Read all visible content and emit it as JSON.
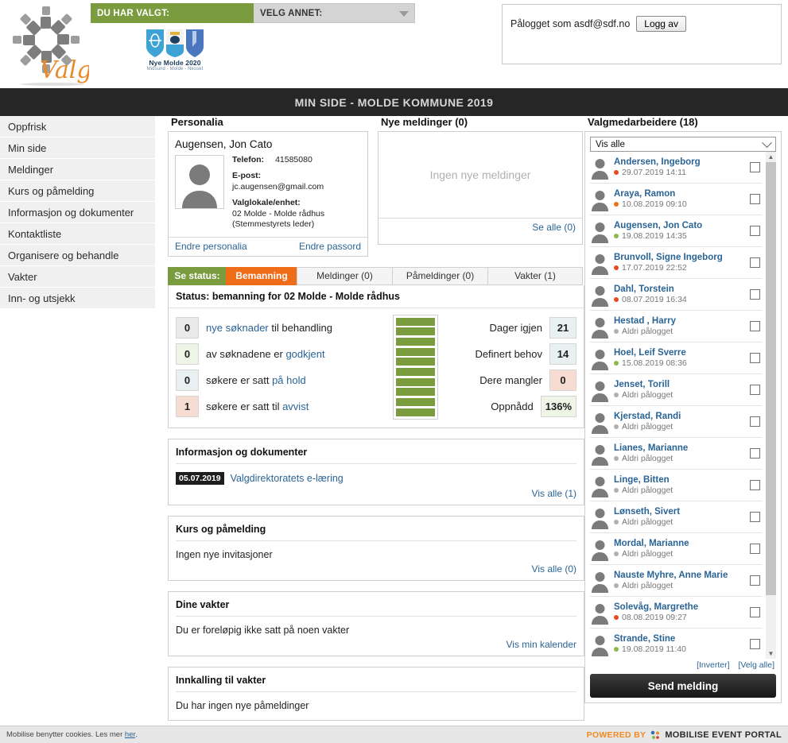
{
  "top": {
    "selected_label": "DU HAR VALGT:",
    "other_label": "VELG ANNET:",
    "crest_title": "Nye Molde 2020",
    "crest_sub": "Midsund - Molde - Nesset",
    "login_text": "Pålogget som asdf@sdf.no",
    "logout_label": "Logg av"
  },
  "header": {
    "title": "MIN SIDE - MOLDE KOMMUNE 2019"
  },
  "sidebar": {
    "items": [
      {
        "label": "Oppfrisk"
      },
      {
        "label": "Min side"
      },
      {
        "label": "Meldinger"
      },
      {
        "label": "Kurs og påmelding"
      },
      {
        "label": "Informasjon og dokumenter"
      },
      {
        "label": "Kontaktliste"
      },
      {
        "label": "Organisere og behandle"
      },
      {
        "label": "Vakter"
      },
      {
        "label": "Inn- og utsjekk"
      }
    ]
  },
  "personalia": {
    "section_title": "Personalia",
    "name": "Augensen, Jon Cato",
    "phone_label": "Telefon:",
    "phone_value": "41585080",
    "email_label": "E-post:",
    "email_value": "jc.augensen@gmail.com",
    "venue_label": "Valglokale/enhet:",
    "venue_value": "02 Molde - Molde rådhus",
    "venue_role": "(Stemmestyrets leder)",
    "edit_personalia": "Endre personalia",
    "edit_password": "Endre passord"
  },
  "messages": {
    "section_title": "Nye meldinger (0)",
    "empty_text": "Ingen nye meldinger",
    "see_all": "Se alle (0)"
  },
  "tabs": {
    "status_label": "Se status:",
    "items": [
      {
        "label": "Bemanning",
        "active": true
      },
      {
        "label": "Meldinger (0)",
        "active": false
      },
      {
        "label": "Påmeldinger (0)",
        "active": false
      },
      {
        "label": "Vakter (1)",
        "active": false
      }
    ]
  },
  "status": {
    "heading": "Status: bemanning for 02 Molde - Molde rådhus",
    "left_rows": [
      {
        "num": "0",
        "text_pre": "",
        "text_link": "nye søknader",
        "text_post": " til behandling",
        "tone": "grey"
      },
      {
        "num": "0",
        "text_pre": "av søknadene er ",
        "text_link": "godkjent",
        "text_post": "",
        "tone": "green"
      },
      {
        "num": "0",
        "text_pre": "søkere er satt ",
        "text_link": "på hold",
        "text_post": "",
        "tone": "blue"
      },
      {
        "num": "1",
        "text_pre": "søkere er satt til ",
        "text_link": "avvist",
        "text_post": "",
        "tone": "red"
      }
    ],
    "bars_filled": 10,
    "bars_total": 10,
    "right_rows": [
      {
        "label": "Dager igjen",
        "value": "21",
        "tone": "blue"
      },
      {
        "label": "Definert behov",
        "value": "14",
        "tone": "blue"
      },
      {
        "label": "Dere mangler",
        "value": "0",
        "tone": "red"
      },
      {
        "label": "Oppnådd",
        "value": "136%",
        "tone": "green"
      }
    ]
  },
  "cards": [
    {
      "title": "Informasjon og dokumenter",
      "date": "05.07.2019",
      "link": "Valgdirektoratets e-læring",
      "plain": "",
      "foot": "Vis alle (1)"
    },
    {
      "title": "Kurs og påmelding",
      "date": "",
      "link": "",
      "plain": "Ingen nye invitasjoner",
      "foot": "Vis alle (0)"
    },
    {
      "title": "Dine vakter",
      "date": "",
      "link": "",
      "plain": "Du er foreløpig ikke satt på noen vakter",
      "foot": "Vis min kalender"
    },
    {
      "title": "Innkalling til vakter",
      "date": "",
      "link": "",
      "plain": "Du har ingen nye påmeldinger",
      "foot": ""
    }
  ],
  "workers": {
    "section_title": "Valgmedarbeidere (18)",
    "filter_value": "Vis alle",
    "invert_label": "[Inverter]",
    "select_all_label": "[Velg alle]",
    "send_label": "Send melding",
    "rows": [
      {
        "name": "Andersen, Ingeborg",
        "time": "29.07.2019 14:11",
        "dot": "#e8491d"
      },
      {
        "name": "Araya, Ramon",
        "time": "10.08.2019 09:10",
        "dot": "#e8731d"
      },
      {
        "name": "Augensen, Jon Cato",
        "time": "19.08.2019 14:35",
        "dot": "#8ab84a"
      },
      {
        "name": "Brunvoll, Signe Ingeborg",
        "time": "17.07.2019 22:52",
        "dot": "#e8491d"
      },
      {
        "name": "Dahl, Torstein",
        "time": "08.07.2019 16:34",
        "dot": "#e8491d"
      },
      {
        "name": "Hestad , Harry",
        "time": "Aldri pålogget",
        "dot": "#b0b0b0"
      },
      {
        "name": "Hoel, Leif Sverre",
        "time": "15.08.2019 08:36",
        "dot": "#8ab84a"
      },
      {
        "name": "Jenset, Torill",
        "time": "Aldri pålogget",
        "dot": "#b0b0b0"
      },
      {
        "name": "Kjerstad, Randi",
        "time": "Aldri pålogget",
        "dot": "#b0b0b0"
      },
      {
        "name": "Lianes, Marianne",
        "time": "Aldri pålogget",
        "dot": "#b0b0b0"
      },
      {
        "name": "Linge, Bitten",
        "time": "Aldri pålogget",
        "dot": "#b0b0b0"
      },
      {
        "name": "Lønseth, Sivert",
        "time": "Aldri pålogget",
        "dot": "#b0b0b0"
      },
      {
        "name": "Mordal, Marianne",
        "time": "Aldri pålogget",
        "dot": "#b0b0b0"
      },
      {
        "name": "Nauste Myhre, Anne Marie",
        "time": "Aldri pålogget",
        "dot": "#b0b0b0"
      },
      {
        "name": "Solevåg, Margrethe",
        "time": "08.08.2019 09:27",
        "dot": "#e8491d"
      },
      {
        "name": "Strande, Stine",
        "time": "19.08.2019 11:40",
        "dot": "#8ab84a"
      }
    ]
  },
  "footer": {
    "cookie_text": "Mobilise benytter cookies. Les mer ",
    "cookie_link": "her",
    "cookie_tail": ".",
    "powered_by": "POWERED BY",
    "brand": "MOBILISE EVENT PORTAL"
  },
  "colors": {
    "green": "#7a9c3e",
    "orange": "#ef6c18",
    "dark": "#262626",
    "link": "#2a6496"
  }
}
